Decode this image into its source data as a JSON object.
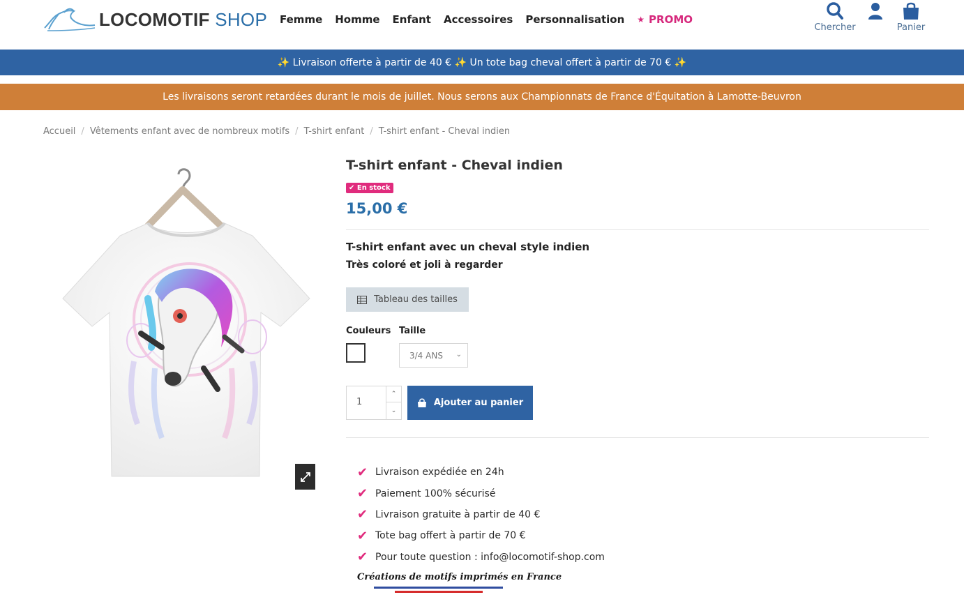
{
  "header": {
    "logo_word1": "LOCOMOTIF",
    "logo_word2": "SHOP",
    "nav": [
      "Femme",
      "Homme",
      "Enfant",
      "Accessoires",
      "Personnalisation"
    ],
    "promo_label": "PROMO",
    "search_label": "Chercher",
    "cart_label": "Panier"
  },
  "banners": {
    "shipping": "✨ Livraison offerte à partir de 40 € ✨ Un tote bag cheval offert à partir de 70 € ✨",
    "notice": "Les livraisons seront retardées durant le mois de juillet. Nous serons aux Championnats de France d'Équitation à Lamotte-Beuvron"
  },
  "breadcrumb": [
    "Accueil",
    "Vêtements enfant avec de nombreux motifs",
    "T-shirt enfant",
    "T-shirt enfant - Cheval indien"
  ],
  "product": {
    "title": "T-shirt enfant - Cheval indien",
    "stock": "En stock",
    "price": "15,00 €",
    "desc_line1": "T-shirt enfant avec un cheval style indien",
    "desc_line2": "Très coloré et joli à regarder",
    "size_chart_label": "Tableau des tailles",
    "colors_label": "Couleurs",
    "size_label": "Taille",
    "size_selected": "3/4 ANS",
    "quantity": "1",
    "add_to_cart": "Ajouter au panier"
  },
  "features": [
    "Livraison expédiée en 24h",
    "Paiement 100% sécurisé",
    "Livraison gratuite à partir de 40 €",
    "Tote bag offert à partir de 70 €",
    "Pour toute question : info@locomotif-shop.com"
  ],
  "made_in_france": "Créations de motifs imprimés en France",
  "colors": {
    "brand_blue": "#2f63a3",
    "accent_pink": "#e02b7d",
    "orange_banner": "#cf7f38"
  }
}
